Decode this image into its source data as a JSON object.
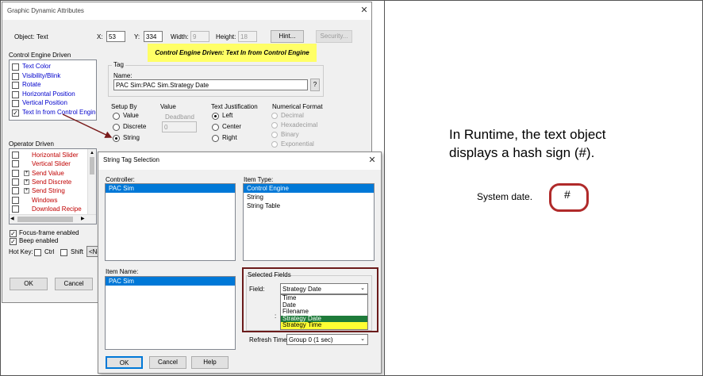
{
  "gda": {
    "title": "Graphic Dynamic Attributes",
    "object_label": "Object:",
    "object_value": "Text",
    "x_label": "X:",
    "x_value": "53",
    "y_label": "Y:",
    "y_value": "334",
    "width_label": "Width:",
    "width_value": "9",
    "height_label": "Height:",
    "height_value": "18",
    "hint_button": "Hint...",
    "security_button": "Security...",
    "banner": "Control Engine Driven: Text In from Control Engine",
    "ced_label": "Control Engine Driven",
    "ced_items": [
      {
        "label": "Text Color",
        "checked": ""
      },
      {
        "label": "Visibility/Blink",
        "checked": ""
      },
      {
        "label": "Rotate",
        "checked": ""
      },
      {
        "label": "Horizontal Position",
        "checked": ""
      },
      {
        "label": "Vertical Position",
        "checked": ""
      },
      {
        "label": "Text In from Control Engine",
        "checked": "✓"
      }
    ],
    "tag_group": "Tag",
    "tag_name_label": "Name:",
    "tag_name_value": "PAC Sim:PAC Sim.Strategy Date",
    "tag_browse": "?",
    "setupby_label": "Setup By",
    "setupby_options": [
      "Value",
      "Discrete",
      "String"
    ],
    "value_label": "Value",
    "deadband_label": "Deadband",
    "deadband_value": "0",
    "justification_label": "Text Justification",
    "justification_options": [
      "Left",
      "Center",
      "Right"
    ],
    "numformat_label": "Numerical Format",
    "numformat_options": [
      "Decimal",
      "Hexadecimal",
      "Binary",
      "Exponential"
    ],
    "operator_label": "Operator Driven",
    "operator_items": [
      {
        "label": "Horizontal Slider",
        "plus": ""
      },
      {
        "label": "Vertical Slider",
        "plus": ""
      },
      {
        "label": "Send Value",
        "plus": "+"
      },
      {
        "label": "Send Discrete",
        "plus": "+"
      },
      {
        "label": "Send String",
        "plus": "+"
      },
      {
        "label": "Windows",
        "plus": ""
      },
      {
        "label": "Download Recipe",
        "plus": ""
      }
    ],
    "focus_frame": "Focus-frame enabled",
    "beep": "Beep enabled",
    "hotkey_label": "Hot Key:",
    "ctrl_label": "Ctrl",
    "shift_label": "Shift",
    "hotkey_trunc": "<No",
    "ok": "OK",
    "cancel": "Cancel"
  },
  "sts": {
    "title": "String Tag Selection",
    "controller_label": "Controller:",
    "controller_items": [
      "PAC Sim"
    ],
    "itemtype_label": "Item Type:",
    "itemtype_items": [
      "Control Engine",
      "String",
      "String Table"
    ],
    "itemname_label": "Item Name:",
    "itemname_items": [
      "PAC Sim"
    ],
    "selected_fields_label": "Selected Fields",
    "field_label": "Field:",
    "field_value": "Strategy Date",
    "field_options": [
      "Time",
      "Date",
      "Filename",
      "Strategy Date",
      "Strategy Time"
    ],
    "refresh_label": "Refresh Time:",
    "refresh_value": "Group 0 (1 sec)",
    "ok": "OK",
    "cancel": "Cancel",
    "help": "Help"
  },
  "annotation": {
    "text": "In Runtime, the text object displays a hash sign (#).",
    "system_date": "System date.",
    "hash": "#"
  },
  "colors": {
    "banner_bg": "#ffff66",
    "highlight_ring": "#b02a2a",
    "selection": "#0078d7",
    "strategy_date_bg": "#1e7b3a",
    "strategy_time_bg": "#ffff33"
  }
}
